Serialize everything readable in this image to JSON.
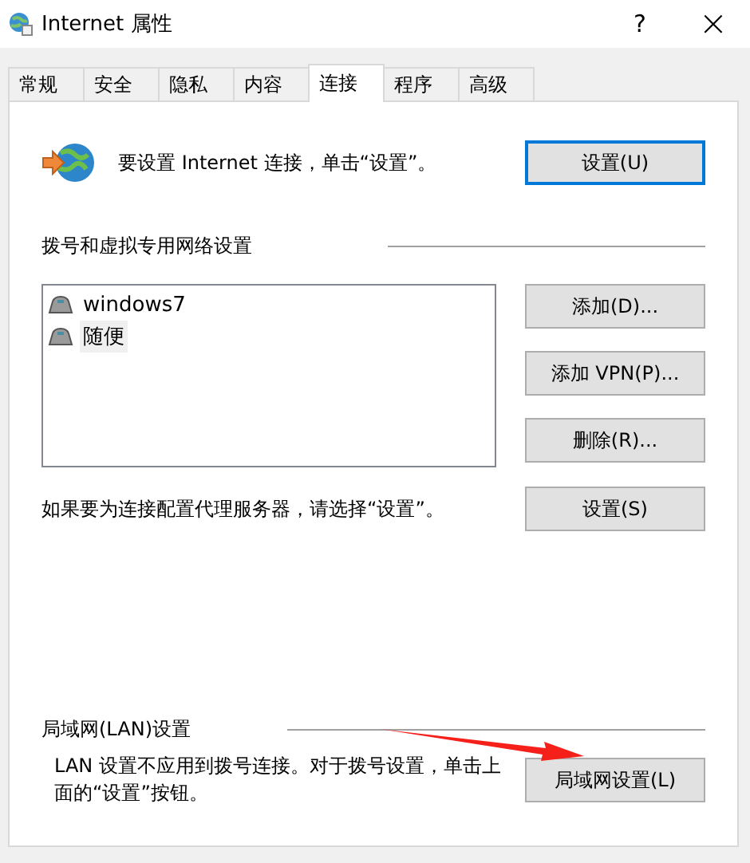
{
  "window": {
    "title": "Internet 属性",
    "help": "?",
    "close": "×"
  },
  "tabs": [
    {
      "label": "常规",
      "selected": false
    },
    {
      "label": "安全",
      "selected": false
    },
    {
      "label": "隐私",
      "selected": false
    },
    {
      "label": "内容",
      "selected": false
    },
    {
      "label": "连接",
      "selected": true
    },
    {
      "label": "程序",
      "selected": false
    },
    {
      "label": "高级",
      "selected": false
    }
  ],
  "setup": {
    "text": "要设置 Internet 连接，单击“设置”。",
    "button": {
      "label": "设置(U)",
      "default": true
    }
  },
  "dialup": {
    "heading": "拨号和虚拟专用网络设置",
    "connections": [
      {
        "name": "windows7",
        "selected": false
      },
      {
        "name": "随便",
        "selected": true
      }
    ],
    "buttons": [
      {
        "label": "添加(D)...",
        "default": false
      },
      {
        "label": "添加 VPN(P)...",
        "default": false
      },
      {
        "label": "删除(R)...",
        "default": false
      }
    ],
    "proxy_text": "如果要为连接配置代理服务器，请选择“设置”。",
    "proxy_button": {
      "label": "设置(S)",
      "default": false
    }
  },
  "lan": {
    "heading": "局域网(LAN)设置",
    "text": "LAN 设置不应用到拨号连接。对于拨号设置，单击上面的“设置”按钮。",
    "button": {
      "label": "局域网设置(L)",
      "default": false
    }
  },
  "annotation": {
    "kind": "arrow"
  }
}
